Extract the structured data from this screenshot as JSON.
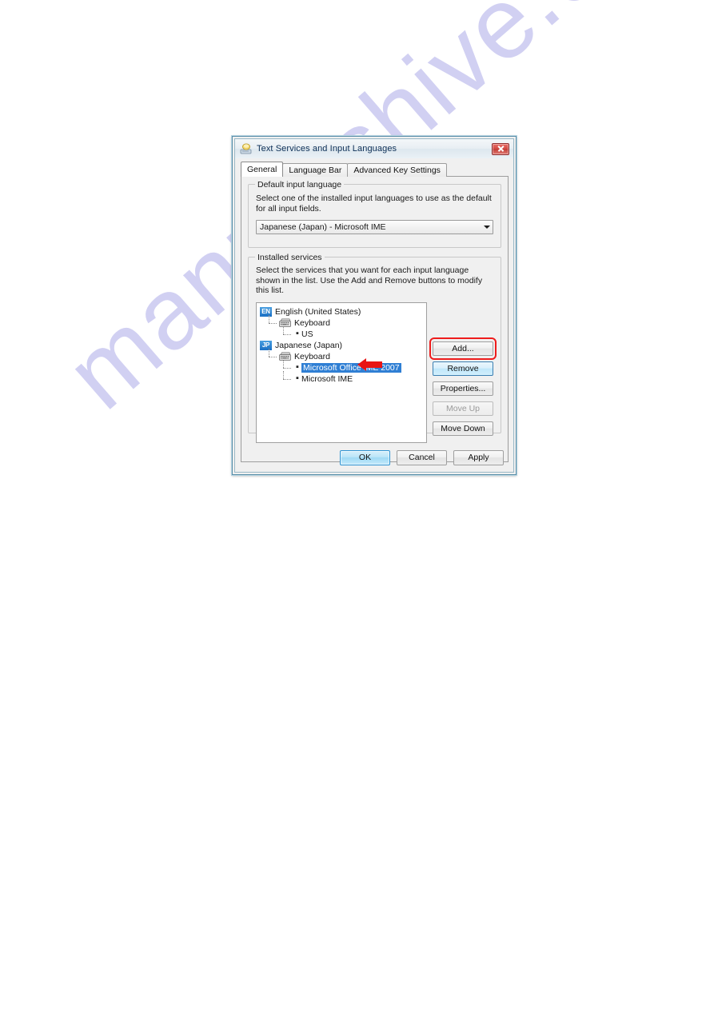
{
  "page": {
    "watermark": "manualshive.com"
  },
  "dialog": {
    "title": "Text Services and Input Languages",
    "title_icon": "text-services-icon",
    "close_icon": "close-icon",
    "tabs": [
      {
        "label": "General",
        "active": true
      },
      {
        "label": "Language Bar",
        "active": false
      },
      {
        "label": "Advanced Key Settings",
        "active": false
      }
    ],
    "default_input_language": {
      "legend": "Default input language",
      "description": "Select one of the installed input languages to use as the default for all input fields.",
      "combo_value": "Japanese (Japan) - Microsoft IME",
      "combo_arrow_icon": "chevron-down-icon"
    },
    "installed_services": {
      "legend": "Installed services",
      "description": "Select the services that you want for each input language shown in the list. Use the Add and Remove buttons to modify this list.",
      "tree": [
        {
          "level": 1,
          "badge": "EN",
          "label": "English (United States)",
          "kind": "language",
          "selected": false
        },
        {
          "level": 2,
          "icon": "keyboard-icon",
          "label": "Keyboard",
          "kind": "category",
          "selected": false
        },
        {
          "level": 3,
          "label": "US",
          "kind": "service",
          "selected": false
        },
        {
          "level": 1,
          "badge": "JP",
          "label": "Japanese (Japan)",
          "kind": "language",
          "selected": false
        },
        {
          "level": 2,
          "icon": "keyboard-icon",
          "label": "Keyboard",
          "kind": "category",
          "selected": false
        },
        {
          "level": 3,
          "label": "Microsoft Office IME 2007",
          "kind": "service",
          "selected": true
        },
        {
          "level": 3,
          "label": "Microsoft IME",
          "kind": "service",
          "selected": false
        }
      ],
      "buttons": [
        {
          "label": "Add...",
          "state": "normal"
        },
        {
          "label": "Remove",
          "state": "highlighted"
        },
        {
          "label": "Properties...",
          "state": "normal"
        },
        {
          "label": "Move Up",
          "state": "disabled"
        },
        {
          "label": "Move Down",
          "state": "normal"
        }
      ]
    },
    "footer_buttons": [
      {
        "label": "OK",
        "default": true
      },
      {
        "label": "Cancel",
        "default": false
      },
      {
        "label": "Apply",
        "default": false
      }
    ]
  },
  "annotations": {
    "arrow_color": "#e81414",
    "box_color": "#ee1c1c",
    "selection_color": "#2f7fd4",
    "arrow_target": "Microsoft Office IME 2007",
    "box_target": "Remove"
  }
}
